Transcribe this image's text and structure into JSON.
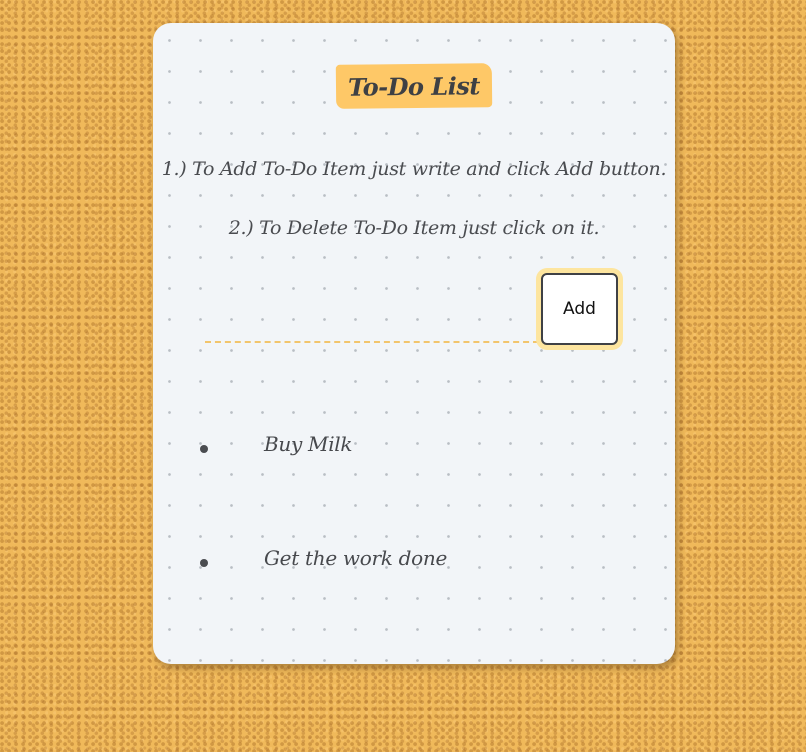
{
  "app": {
    "title": "To-Do List",
    "instructions": [
      "1.) To Add To-Do Item just write and click Add button.",
      "2.) To Delete To-Do Item just click on it."
    ]
  },
  "form": {
    "input_value": "",
    "input_placeholder": "",
    "add_label": "Add"
  },
  "todos": [
    {
      "text": "Buy Milk"
    },
    {
      "text": "Get the work done"
    }
  ],
  "colors": {
    "background": "#f0b95a",
    "card": "#f2f5f8",
    "title_highlight": "#fec867",
    "input_underline": "#f2c56c",
    "button_glow": "#fde59f",
    "text": "#47494d"
  },
  "icons": {
    "bullet": "bullet-dot-icon"
  }
}
